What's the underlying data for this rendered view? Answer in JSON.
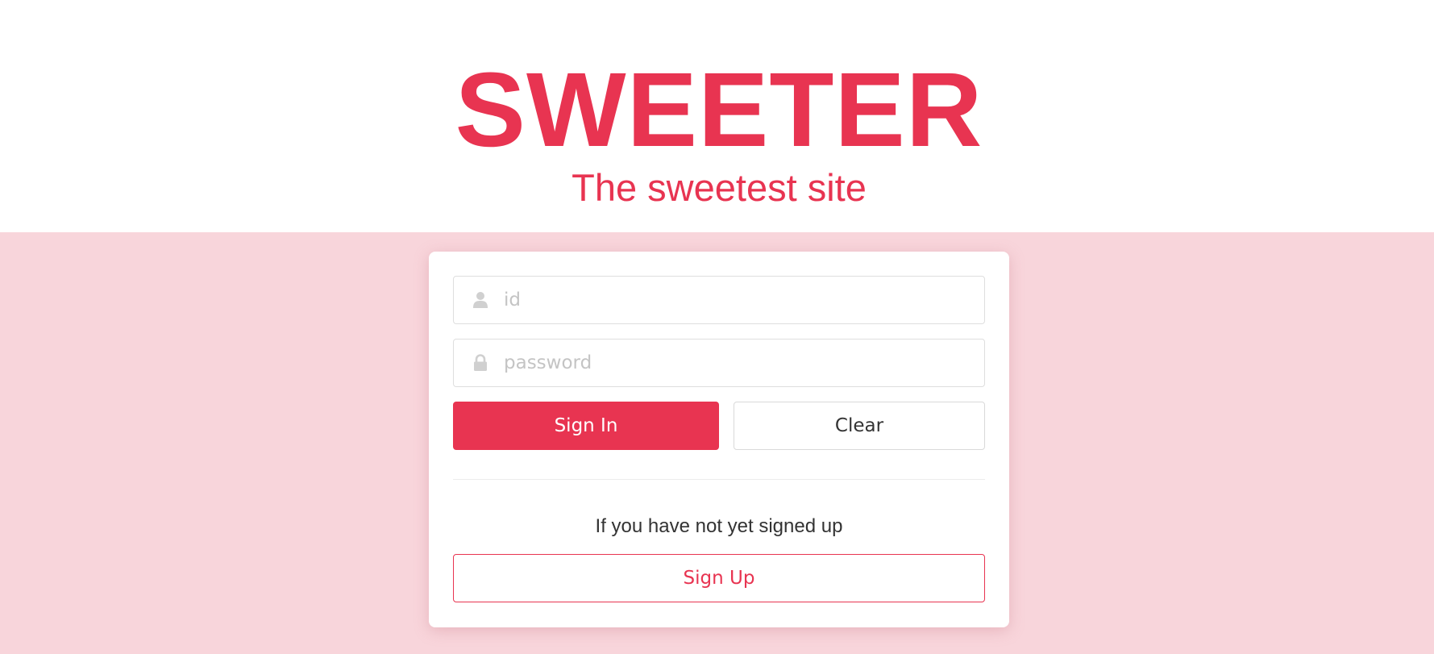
{
  "brand": {
    "logo": "SWEETER",
    "tagline": "The sweetest site"
  },
  "login": {
    "id_field": {
      "placeholder": "id",
      "value": "",
      "icon": "user-icon"
    },
    "password_field": {
      "placeholder": "password",
      "value": "",
      "icon": "lock-icon"
    },
    "signin_label": "Sign In",
    "clear_label": "Clear",
    "signup_hint": "If you have not yet signed up",
    "signup_label": "Sign Up"
  },
  "colors": {
    "accent": "#e83451",
    "background_pink": "#f8d5db",
    "card": "#ffffff",
    "icon_gray": "#d0d0d0"
  }
}
